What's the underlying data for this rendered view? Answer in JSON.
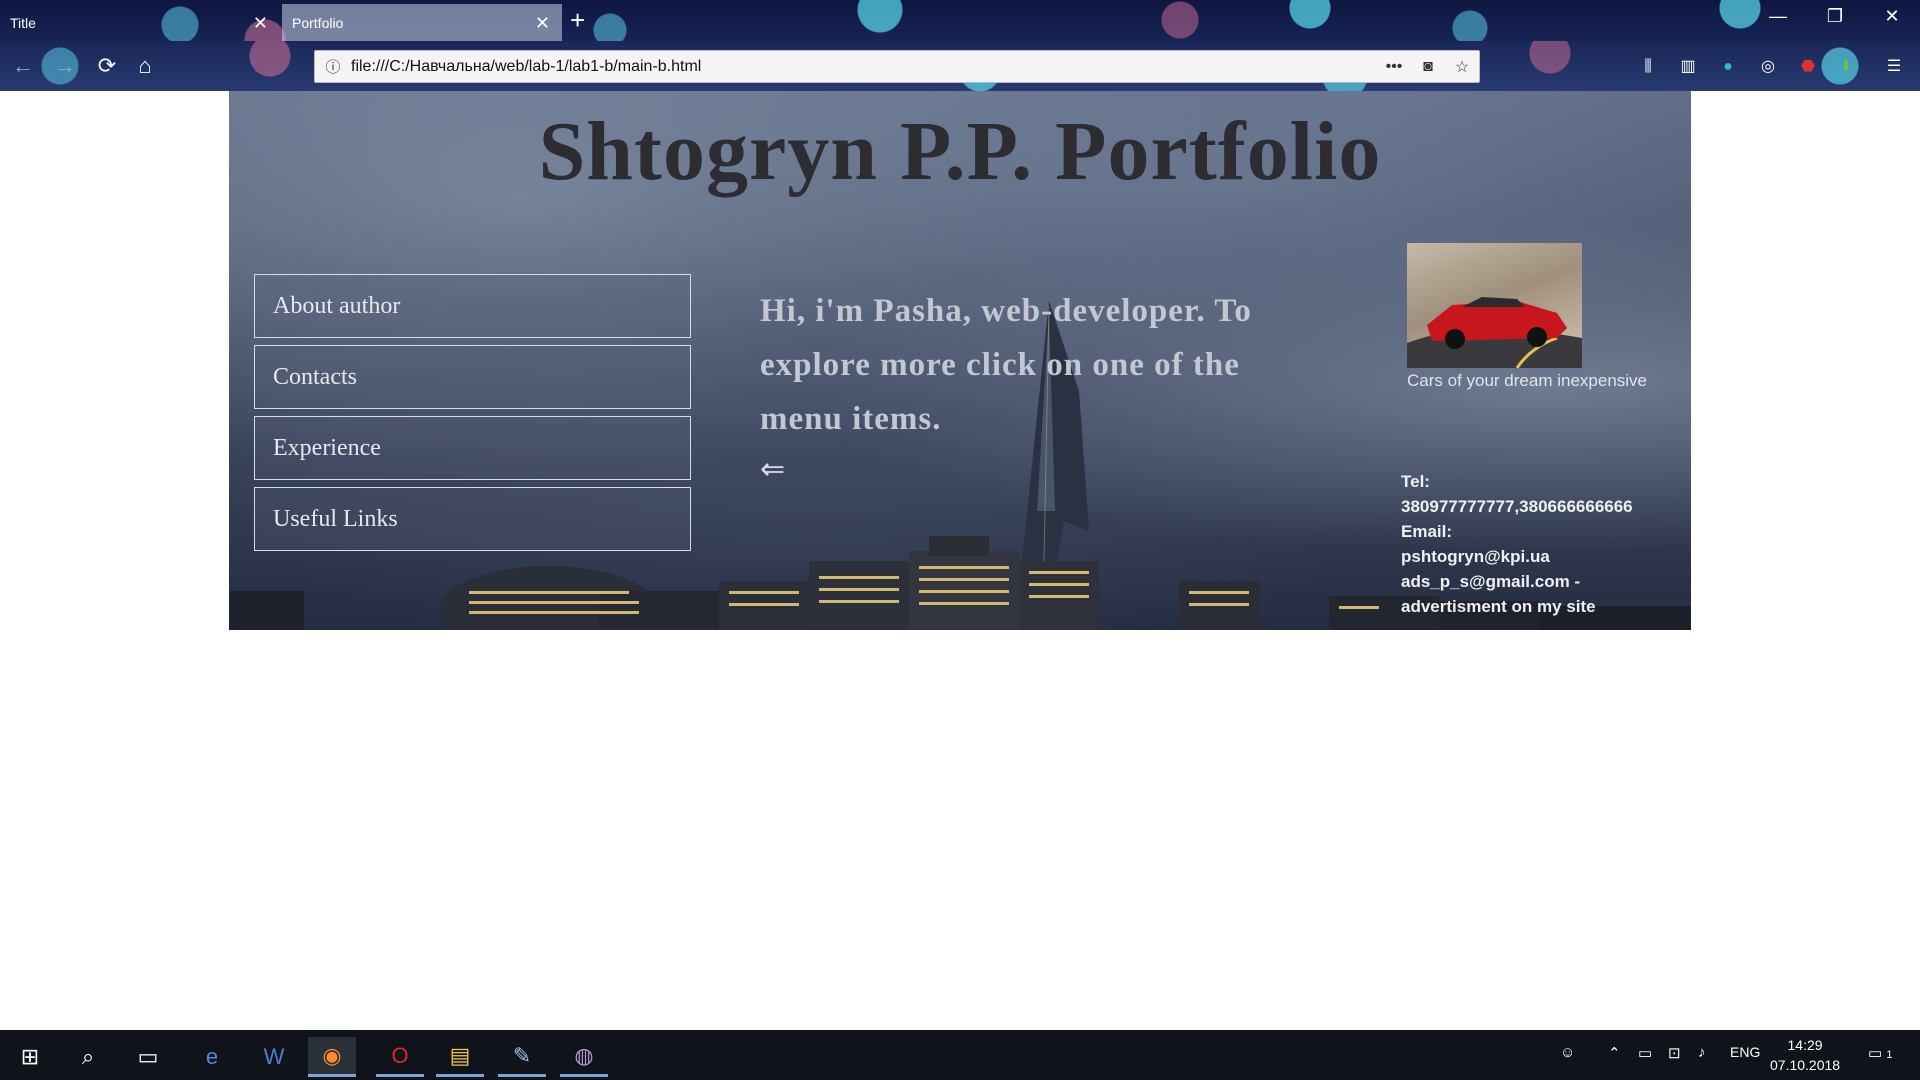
{
  "browser": {
    "tabs": [
      {
        "label": "Title",
        "active": false
      },
      {
        "label": "Portfolio",
        "active": true
      }
    ],
    "url": "file:///C:/Навчальна/web/lab-1/lab1-b/main-b.html",
    "icons": {
      "back": "arrow-left-icon",
      "forward": "arrow-right-icon",
      "reload": "reload-icon",
      "home": "home-icon",
      "info": "info-icon",
      "more": "more-icon",
      "pocket": "pocket-icon",
      "bookmark": "star-icon",
      "library": "library-icon",
      "sidebar": "sidebar-icon",
      "menu": "hamburger-menu-icon"
    }
  },
  "page": {
    "title": "Shtogryn P.P. Portfolio",
    "menu": [
      {
        "label": "About author"
      },
      {
        "label": "Contacts"
      },
      {
        "label": "Experience"
      },
      {
        "label": "Useful Links"
      }
    ],
    "greeting": "Hi, i'm Pasha, web-developer. To explore more click on one of the menu items.",
    "back_arrow": "⇐",
    "ad": {
      "caption": "Cars of your dream inexpensive"
    },
    "contacts": {
      "tel_label": "Tel:",
      "tel": "380977777777,380666666666",
      "email_label": "Email:",
      "email_1": "pshtogryn@kpi.ua",
      "email_2": "ads_p_s@gmail.com -",
      "email_2_note": "advertisment on my site"
    }
  },
  "taskbar": {
    "language": "ENG",
    "time": "14:29",
    "date": "07.10.2018",
    "notifications": "1"
  },
  "colors": {
    "titlebar": "#0f1640",
    "heart_cyan": "#5ad2f0",
    "heart_pink": "#e678a0",
    "page_title": "#2c2c32",
    "taskbar": "#10141a"
  }
}
